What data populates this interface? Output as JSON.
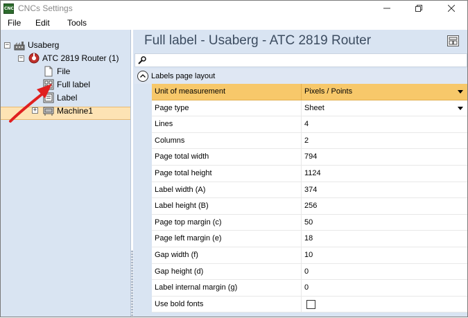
{
  "window": {
    "title": "CNCs Settings",
    "app_icon_text": "CNC",
    "controls": {
      "minimize": "—",
      "maximize": "❐",
      "close": "✕"
    }
  },
  "menu": [
    "File",
    "Edit",
    "Tools"
  ],
  "tree": {
    "root": {
      "label": "Usaberg",
      "expander": "⊟"
    },
    "machine": {
      "label": "ATC 2819 Router (1)",
      "expander": "⊟"
    },
    "items": [
      {
        "label": "File",
        "icon": "file-icon"
      },
      {
        "label": "Full label",
        "icon": "full-label-icon",
        "selected": true
      },
      {
        "label": "Label",
        "icon": "label-icon"
      }
    ],
    "machine1": {
      "label": "Machine1",
      "expander": "⊞"
    }
  },
  "header": {
    "title": "Full label - Usaberg - ATC 2819 Router"
  },
  "search": {
    "icon": "search-icon",
    "glyph": "🔑"
  },
  "section": {
    "label": "Labels page layout",
    "toggle": "⌃"
  },
  "properties": {
    "header": {
      "name": "Unit of measurement",
      "value": "Pixels / Points"
    },
    "rows": [
      {
        "name": "Page type",
        "value": "Sheet",
        "dropdown": true
      },
      {
        "name": "Lines",
        "value": "4"
      },
      {
        "name": "Columns",
        "value": "2"
      },
      {
        "name": "Page total width",
        "value": "794"
      },
      {
        "name": "Page total height",
        "value": "1124"
      },
      {
        "name": "Label width (A)",
        "value": "374"
      },
      {
        "name": "Label height (B)",
        "value": "256"
      },
      {
        "name": "Page top margin (c)",
        "value": "50"
      },
      {
        "name": "Page left margin (e)",
        "value": "18"
      },
      {
        "name": "Gap width (f)",
        "value": "10"
      },
      {
        "name": "Gap height (d)",
        "value": "0"
      },
      {
        "name": "Label internal margin (g)",
        "value": "0"
      },
      {
        "name": "Use bold fonts",
        "value": "",
        "checkbox": true,
        "checked": false
      }
    ]
  },
  "colors": {
    "accent_header": "#f7c86a",
    "selection": "#fde3b4",
    "panel": "#d9e4f2",
    "annotation_arrow": "#e02020"
  }
}
